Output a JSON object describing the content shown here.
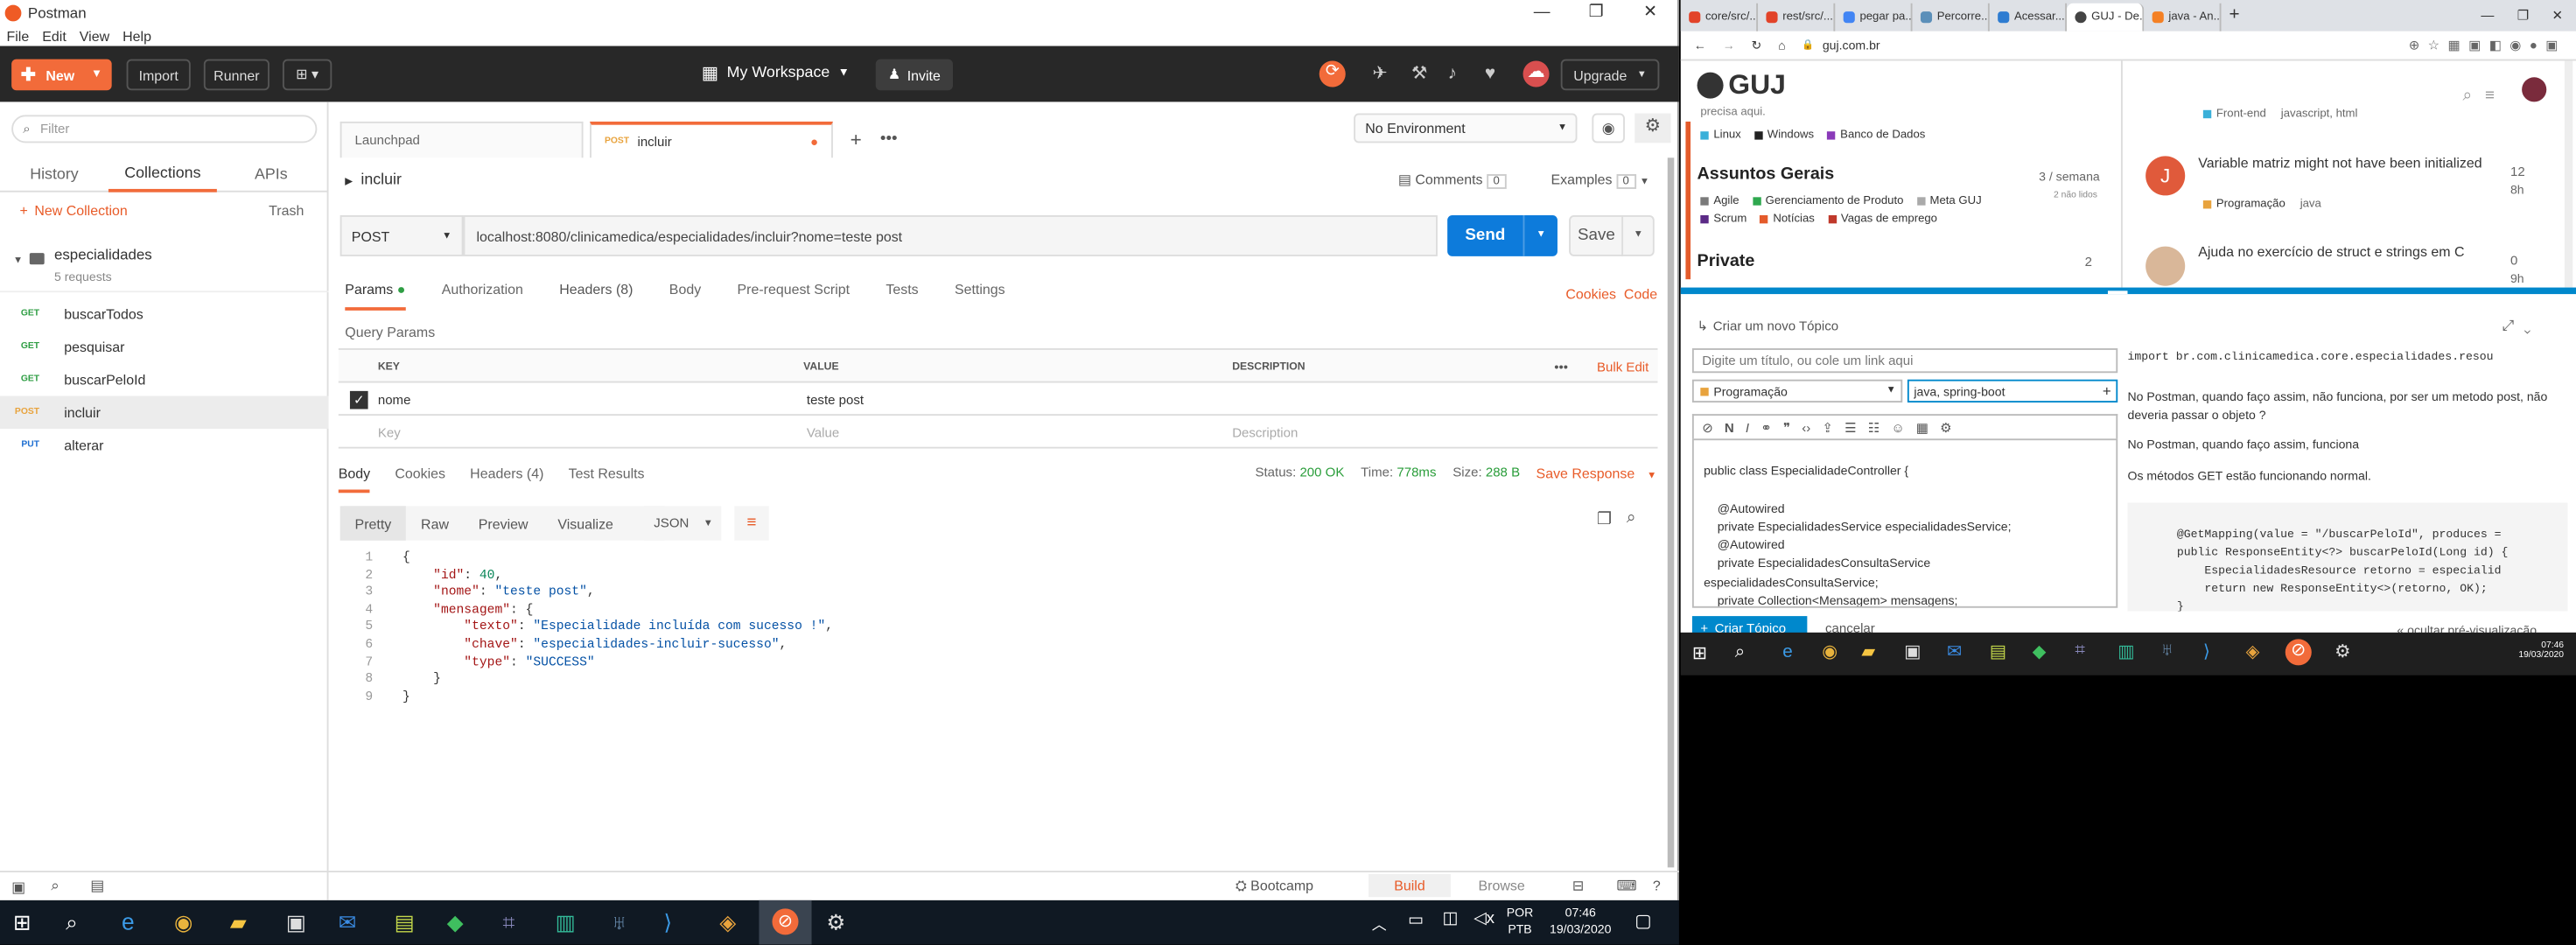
{
  "postman": {
    "window_title": "Postman",
    "menu": [
      "File",
      "Edit",
      "View",
      "Help"
    ],
    "header": {
      "new": "New",
      "import": "Import",
      "runner": "Runner",
      "workspace": "My Workspace",
      "invite": "Invite",
      "upgrade": "Upgrade"
    },
    "sidebar": {
      "filter_placeholder": "Filter",
      "tabs": [
        "History",
        "Collections",
        "APIs"
      ],
      "new_collection": "New Collection",
      "trash": "Trash",
      "collection": {
        "name": "especialidades",
        "count": "5 requests"
      },
      "requests": [
        {
          "method": "GET",
          "name": "buscarTodos",
          "color": "#2f9e44"
        },
        {
          "method": "GET",
          "name": "pesquisar",
          "color": "#2f9e44"
        },
        {
          "method": "GET",
          "name": "buscarPeloId",
          "color": "#2f9e44"
        },
        {
          "method": "POST",
          "name": "incluir",
          "color": "#e8a33d"
        },
        {
          "method": "PUT",
          "name": "alterar",
          "color": "#1f6fd1"
        }
      ]
    },
    "tabs": [
      {
        "label": "Launchpad"
      },
      {
        "method": "POST",
        "label": "incluir"
      }
    ],
    "environment": "No Environment",
    "request": {
      "name": "incluir",
      "comments": "Comments",
      "comments_count": "0",
      "examples": "Examples",
      "examples_count": "0",
      "method": "POST",
      "url": "localhost:8080/clinicamedica/especialidades/incluir?nome=teste post",
      "send": "Send",
      "save": "Save",
      "tabs": [
        "Params",
        "Authorization",
        "Headers (8)",
        "Body",
        "Pre-request Script",
        "Tests",
        "Settings"
      ],
      "cookies": "Cookies",
      "code": "Code",
      "query_params_label": "Query Params",
      "columns": [
        "KEY",
        "VALUE",
        "DESCRIPTION"
      ],
      "bulk_edit": "Bulk Edit",
      "param": {
        "key": "nome",
        "value": "teste post"
      },
      "placeholders": {
        "key": "Key",
        "value": "Value",
        "description": "Description"
      }
    },
    "response": {
      "tabs": [
        "Body",
        "Cookies",
        "Headers (4)",
        "Test Results"
      ],
      "status_label": "Status:",
      "status": "200 OK",
      "time_label": "Time:",
      "time": "778ms",
      "size_label": "Size:",
      "size": "288 B",
      "save_response": "Save Response",
      "formats": [
        "Pretty",
        "Raw",
        "Preview",
        "Visualize"
      ],
      "format_type": "JSON",
      "body": {
        "id": "40",
        "nome": "\"teste post\"",
        "texto": "\"Especialidade incluída com sucesso !\"",
        "chave": "\"especialidades-incluir-sucesso\"",
        "type": "\"SUCCESS\""
      }
    },
    "statusbar": {
      "bootcamp": "Bootcamp",
      "build": "Build",
      "browse": "Browse"
    }
  },
  "browser": {
    "tabs": [
      "core/src/...",
      "rest/src/...",
      "pegar pa...",
      "Percorre...",
      "Acessar...",
      "GUJ - De...",
      "java - An..."
    ],
    "url": "guj.com.br",
    "site": {
      "logo": "GUJ",
      "cut_text": "precisa aqui.",
      "cats_top": [
        "Linux",
        "Windows",
        "Banco de Dados"
      ],
      "section_general": "Assuntos Gerais",
      "general_rate": "3 / semana",
      "general_unread": "2 não lidos",
      "general_cats": [
        "Agile",
        "Gerenciamento de Produto",
        "Meta GUJ",
        "Scrum",
        "Notícias",
        "Vagas de emprego"
      ],
      "section_private": "Private",
      "private_count": "2",
      "topic_cut_tags": [
        "Front-end",
        "javascript, html"
      ],
      "topics": [
        {
          "title": "Variable matriz might not have been initialized",
          "category": "Programação",
          "tag": "java",
          "replies": "12",
          "age": "8h"
        },
        {
          "title": "Ajuda no exercício de struct e strings em C",
          "category": "Programação",
          "tag": "",
          "replies": "0",
          "age": "9h"
        }
      ]
    },
    "composer": {
      "header": "Criar um novo Tópico",
      "title_placeholder": "Digite um título, ou cole um link aqui",
      "category": "Programação",
      "tags": "java, spring-boot",
      "editor_lines": [
        "public class EspecialidadeController {",
        "",
        "    @Autowired",
        "    private EspecialidadesService especialidadesService;",
        "    @Autowired",
        "    private EspecialidadesConsultaService",
        "especialidadesConsultaService;",
        "    private Collection<Mensagem> mensagens;"
      ],
      "preview": {
        "import": "import br.com.clinicamedica.core.especialidades.resou",
        "p1": "No Postman, quando faço assim, não funciona, por ser um metodo post, não deveria passar o objeto ?",
        "p2": "No Postman, quando faço assim, funciona",
        "p3": "Os métodos GET estão funcionando normal.",
        "code": [
          "@GetMapping(value = \"/buscarPeloId\", produces =",
          "public ResponseEntity<?> buscarPeloId(Long id) {",
          "    EspecialidadesResource retorno = especialid",
          "    return new ResponseEntity<>(retorno, OK);",
          "}"
        ]
      },
      "create": "Criar Tópico",
      "cancel": "cancelar",
      "hide_preview": "« ocultar pré-visualização"
    }
  },
  "taskbar": {
    "lang1": "POR",
    "lang2": "PTB",
    "time": "07:46",
    "date": "19/03/2020",
    "time_small": "07:46",
    "date_small": "19/03/2020"
  }
}
